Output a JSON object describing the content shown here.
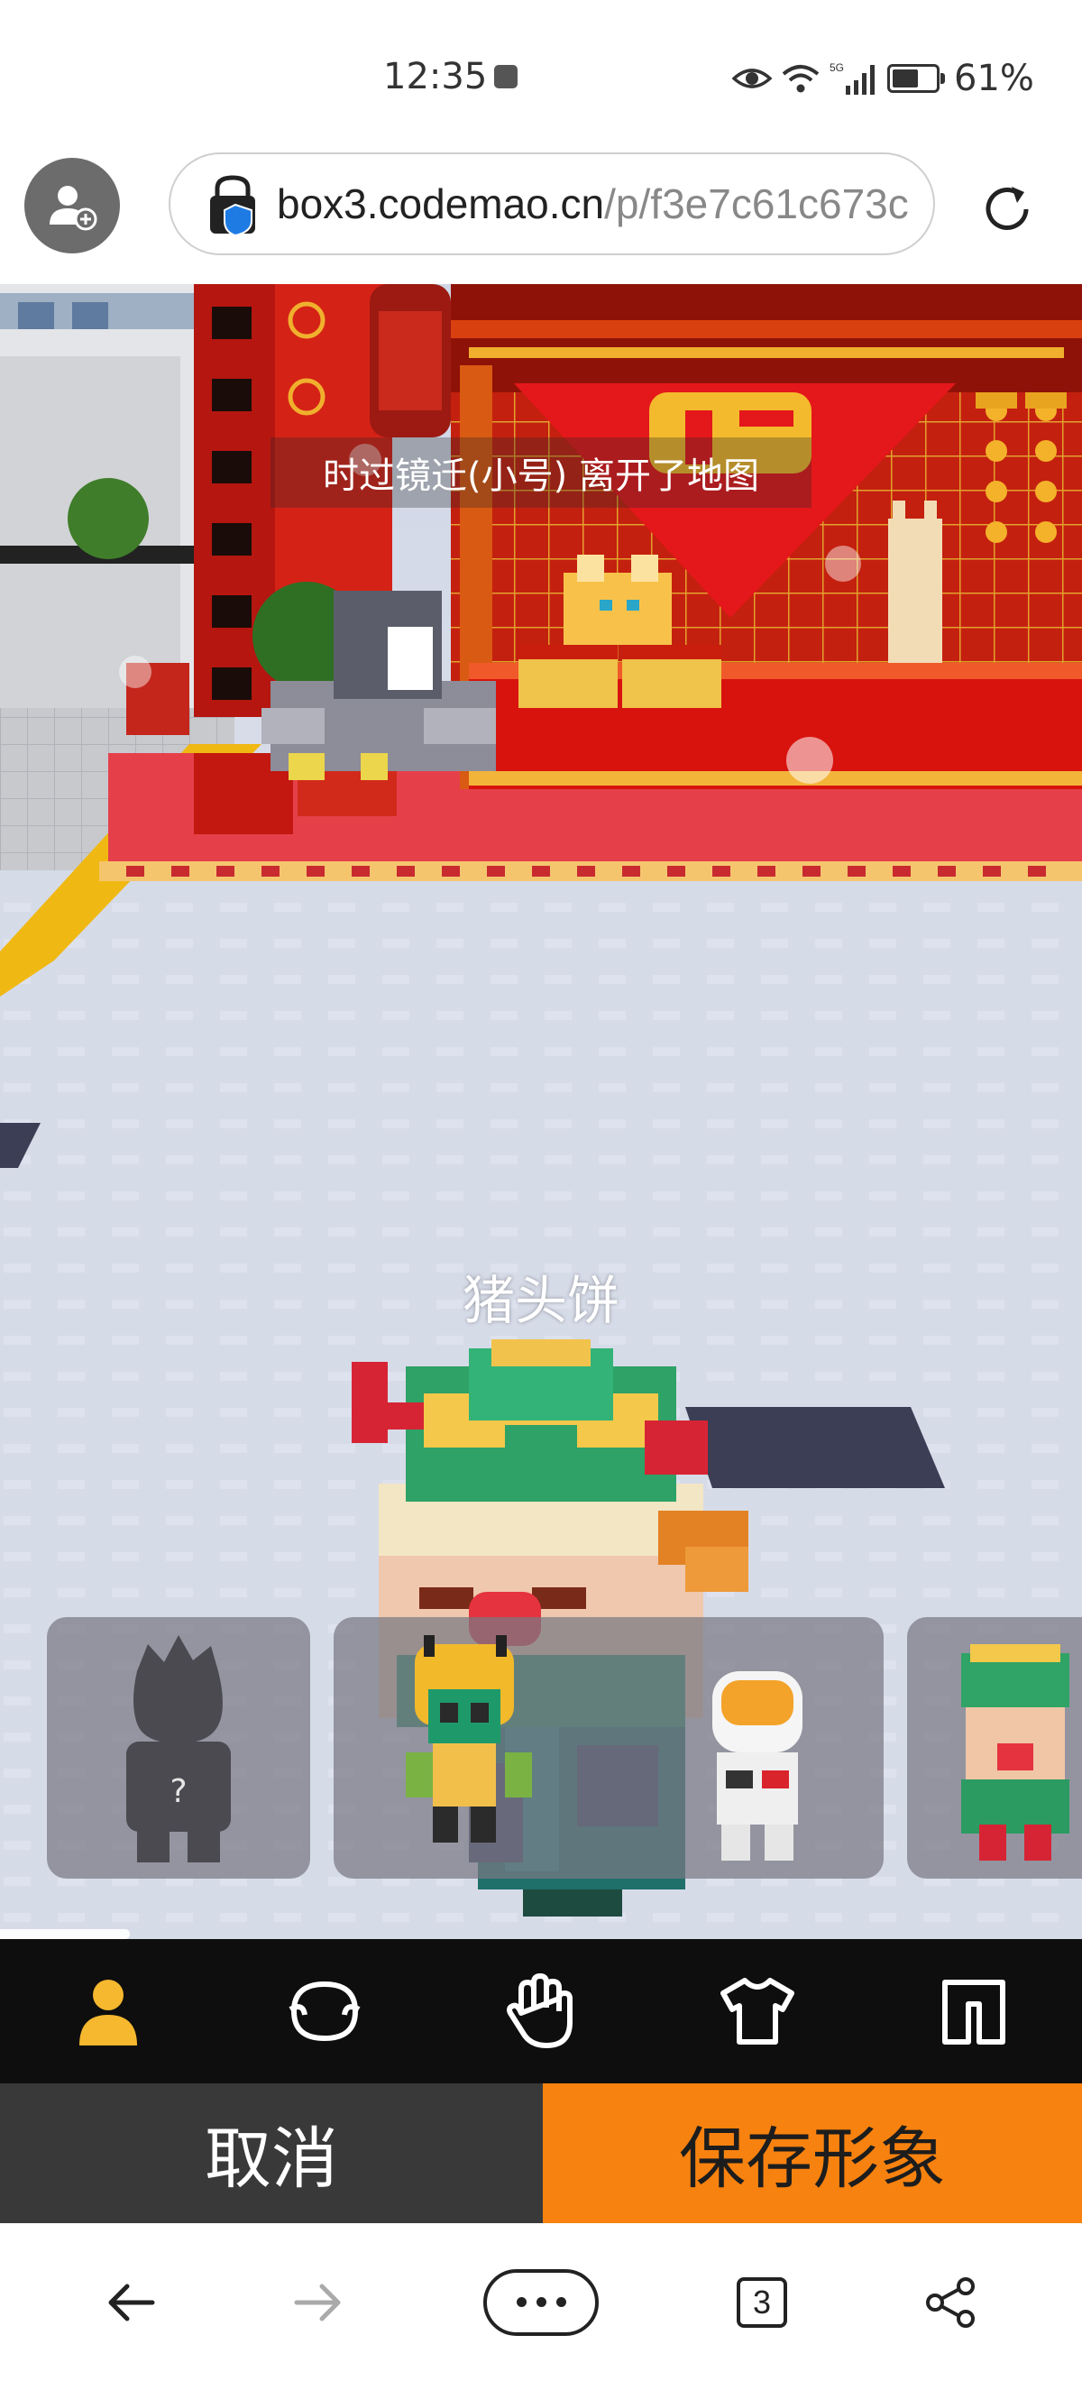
{
  "status_bar": {
    "time": "12:35",
    "network": "5G",
    "battery_percent": "61%",
    "battery_level": 0.61
  },
  "address_bar": {
    "url_host": "box3.codemao.cn",
    "url_path": "/p/f3e7c61c673c"
  },
  "game": {
    "notice": "时过镜迁(小号) 离开了地图",
    "player_name": "猪头饼",
    "avatar_cards": [
      {
        "label": "?",
        "kind": "placeholder"
      },
      {
        "label": "",
        "kind": "bee-girl"
      },
      {
        "label": "",
        "kind": "astronaut"
      },
      {
        "label": "",
        "kind": "guan-yu"
      }
    ],
    "scroll_progress": 0.12
  },
  "editor_tabs": [
    {
      "icon": "person-icon",
      "active": true,
      "color": "#f5b82e"
    },
    {
      "icon": "head-icon",
      "active": false
    },
    {
      "icon": "hand-icon",
      "active": false
    },
    {
      "icon": "shirt-icon",
      "active": false
    },
    {
      "icon": "frame-icon",
      "active": false
    }
  ],
  "actions": {
    "cancel_label": "取消",
    "save_label": "保存形象",
    "save_color": "#f8820f",
    "cancel_color": "#393939"
  },
  "browser_nav": {
    "tab_count": "3",
    "items": [
      "back-icon",
      "forward-icon",
      "more-icon",
      "tabs-icon",
      "share-icon"
    ]
  }
}
